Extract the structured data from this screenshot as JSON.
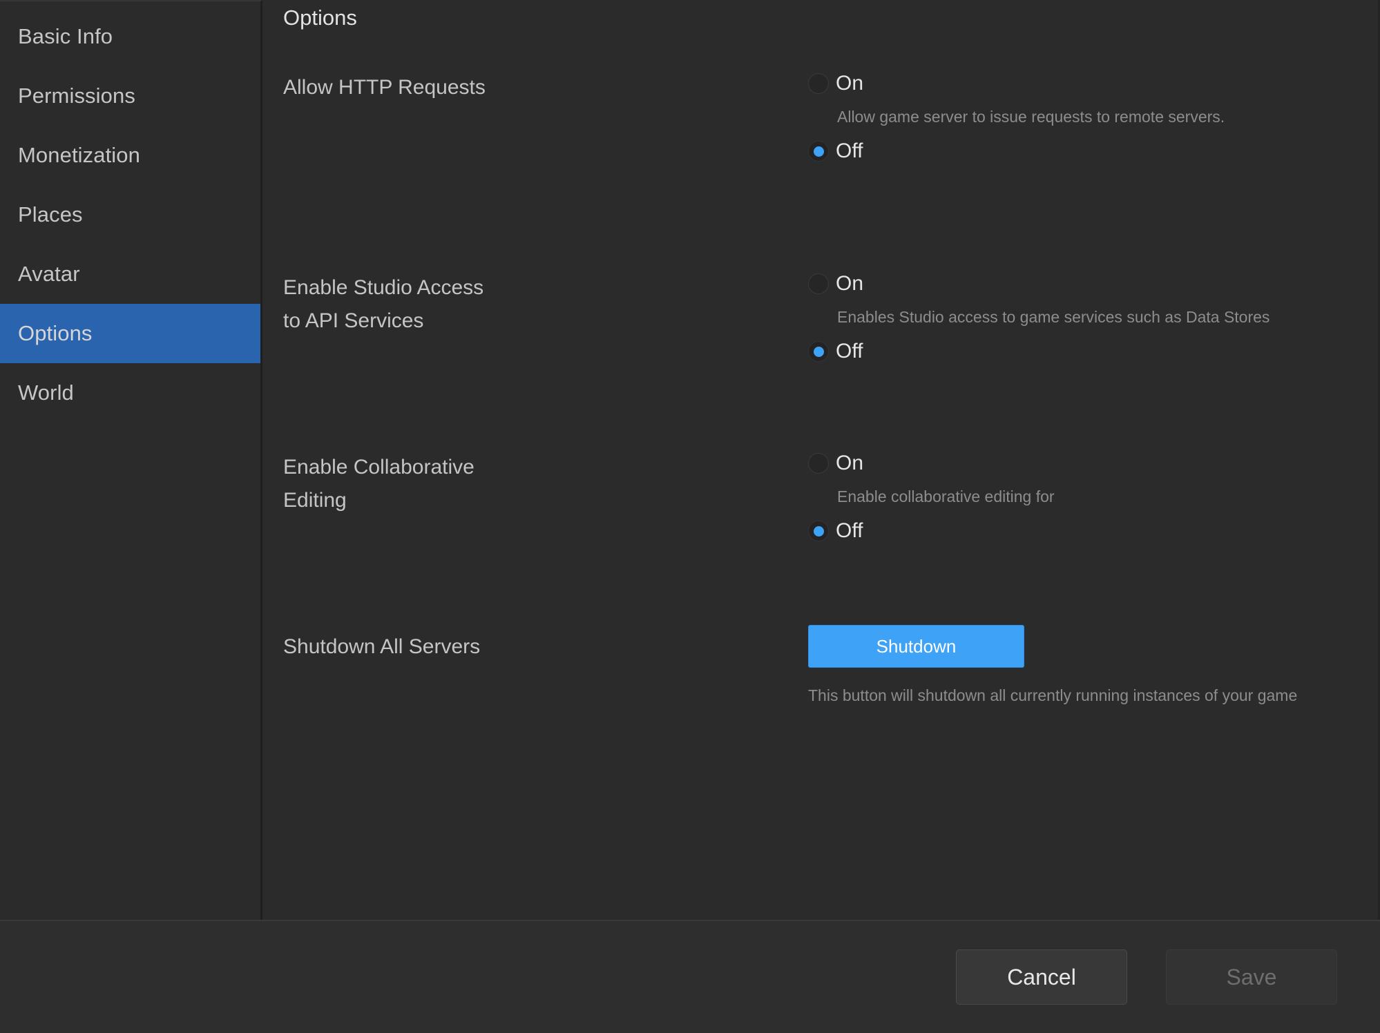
{
  "sidebar": {
    "items": [
      {
        "label": "Basic Info",
        "active": false
      },
      {
        "label": "Permissions",
        "active": false
      },
      {
        "label": "Monetization",
        "active": false
      },
      {
        "label": "Places",
        "active": false
      },
      {
        "label": "Avatar",
        "active": false
      },
      {
        "label": "Options",
        "active": true
      },
      {
        "label": "World",
        "active": false
      }
    ]
  },
  "page": {
    "title": "Options"
  },
  "settings": [
    {
      "label": "Allow HTTP Requests",
      "on_label": "On",
      "off_label": "Off",
      "selected": "Off",
      "description": "Allow game server to issue requests to remote servers."
    },
    {
      "label": "Enable Studio Access\nto API Services",
      "on_label": "On",
      "off_label": "Off",
      "selected": "Off",
      "description": "Enables Studio access to game services such as Data Stores"
    },
    {
      "label": "Enable Collaborative\nEditing",
      "on_label": "On",
      "off_label": "Off",
      "selected": "Off",
      "description": "Enable collaborative editing for"
    }
  ],
  "shutdown": {
    "label": "Shutdown All Servers",
    "button_label": "Shutdown",
    "description": "This button will shutdown all currently running instances of your game"
  },
  "footer": {
    "cancel_label": "Cancel",
    "save_label": "Save",
    "save_disabled": true
  },
  "colors": {
    "accent_blue": "#3ea2f7",
    "nav_active_blue": "#2a64ae",
    "background": "#2b2b2b",
    "footer_background": "#2e2e2e",
    "helper_text": "#8d8d8d"
  }
}
